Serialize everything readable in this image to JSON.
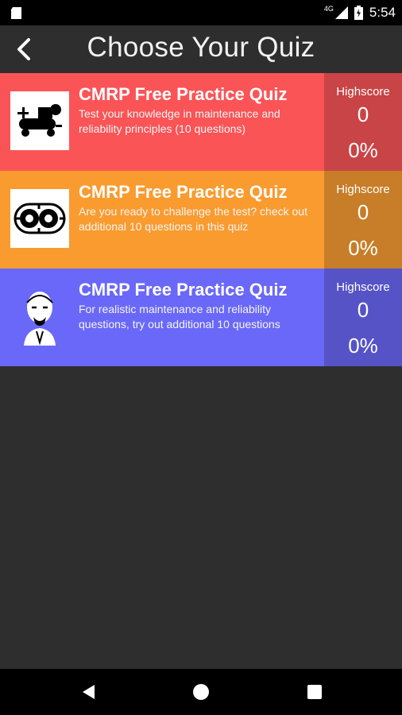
{
  "status_bar": {
    "network": "4G",
    "time": "5:54"
  },
  "header": {
    "title": "Choose Your Quiz",
    "back_icon": "back-arrow-icon"
  },
  "colors": {
    "background": "#2e2e2e",
    "card_1": "#fa5457",
    "card_1_score": "#c94446",
    "card_2": "#fa9b2f",
    "card_2_score": "#c87d28",
    "card_3": "#6a68f8",
    "card_3_score": "#5553c6"
  },
  "quizzes": [
    {
      "title": "CMRP Free Practice Quiz",
      "description": "Test your knowledge in maintenance and reliability principles (10 questions)",
      "highscore_label": "Highscore",
      "highscore": "0",
      "percent": "0%",
      "icon": "air-compressor-icon"
    },
    {
      "title": "CMRP Free Practice Quiz",
      "description": "Are you ready to challenge the test? check out additional 10 questions in this quiz",
      "highscore_label": "Highscore",
      "highscore": "0",
      "percent": "0%",
      "icon": "gear-pump-icon"
    },
    {
      "title": "CMRP Free Practice Quiz",
      "description": " For realistic maintenance and reliability questions, try out additional 10 questions",
      "highscore_label": "Highscore",
      "highscore": "0",
      "percent": "0%",
      "icon": "portrait-icon"
    }
  ],
  "nav_bar": {
    "icons": [
      "back-triangle-icon",
      "home-circle-icon",
      "recents-square-icon"
    ]
  }
}
